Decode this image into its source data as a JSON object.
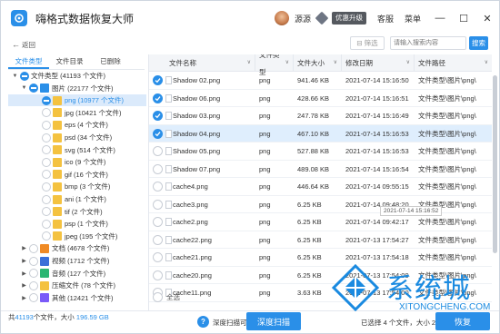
{
  "app": {
    "title": "嗨格式数据恢复大师",
    "user": "源源",
    "upgrade": "优惠升级",
    "service": "客服",
    "menu": "菜单"
  },
  "toolbar": {
    "back": "返回",
    "filter": "筛选",
    "search_placeholder": "请输入搜索内容",
    "search_btn": "搜索"
  },
  "left": {
    "tabs": [
      "文件类型",
      "文件目录",
      "已删除"
    ],
    "tree": [
      {
        "label": "文件类型 (41193 个文件)",
        "lvl": 0,
        "arrow": "▼",
        "cb": "part",
        "icon": null
      },
      {
        "label": "图片 (22177 个文件)",
        "lvl": 1,
        "arrow": "▼",
        "cb": "part",
        "icon": "#2a8fe8"
      },
      {
        "label": "png (10977 个文件)",
        "lvl": 2,
        "arrow": "",
        "cb": "full",
        "icon": "#f4c240",
        "sel": true
      },
      {
        "label": "jpg (10421 个文件)",
        "lvl": 2,
        "arrow": "",
        "cb": "",
        "icon": "#f4c240"
      },
      {
        "label": "eps (4 个文件)",
        "lvl": 2,
        "arrow": "",
        "cb": "",
        "icon": "#f4c240"
      },
      {
        "label": "psd (34 个文件)",
        "lvl": 2,
        "arrow": "",
        "cb": "",
        "icon": "#f4c240"
      },
      {
        "label": "svg (514 个文件)",
        "lvl": 2,
        "arrow": "",
        "cb": "",
        "icon": "#f4c240"
      },
      {
        "label": "ico (9 个文件)",
        "lvl": 2,
        "arrow": "",
        "cb": "",
        "icon": "#f4c240"
      },
      {
        "label": "gif (16 个文件)",
        "lvl": 2,
        "arrow": "",
        "cb": "",
        "icon": "#f4c240"
      },
      {
        "label": "bmp (3 个文件)",
        "lvl": 2,
        "arrow": "",
        "cb": "",
        "icon": "#f4c240"
      },
      {
        "label": "ani (1 个文件)",
        "lvl": 2,
        "arrow": "",
        "cb": "",
        "icon": "#f4c240"
      },
      {
        "label": "tif (2 个文件)",
        "lvl": 2,
        "arrow": "",
        "cb": "",
        "icon": "#f4c240"
      },
      {
        "label": "psp (1 个文件)",
        "lvl": 2,
        "arrow": "",
        "cb": "",
        "icon": "#f4c240"
      },
      {
        "label": "jpeg (195 个文件)",
        "lvl": 2,
        "arrow": "",
        "cb": "",
        "icon": "#f4c240"
      },
      {
        "label": "文档 (4678 个文件)",
        "lvl": 1,
        "arrow": "▶",
        "cb": "",
        "icon": "#f08a24"
      },
      {
        "label": "视频 (1712 个文件)",
        "lvl": 1,
        "arrow": "▶",
        "cb": "",
        "icon": "#3a6fd8"
      },
      {
        "label": "音频 (127 个文件)",
        "lvl": 1,
        "arrow": "▶",
        "cb": "",
        "icon": "#2bb673"
      },
      {
        "label": "压缩文件 (78 个文件)",
        "lvl": 1,
        "arrow": "▶",
        "cb": "",
        "icon": "#f4c240"
      },
      {
        "label": "其他 (12421 个文件)",
        "lvl": 1,
        "arrow": "▶",
        "cb": "",
        "icon": "#7a5af8"
      }
    ],
    "footer_prefix": "共",
    "footer_count": "41193",
    "footer_mid": "个文件，大小",
    "footer_size": "196.59 GB"
  },
  "grid": {
    "headers": [
      "文件名称",
      "文件类型",
      "文件大小",
      "修改日期",
      "文件路径"
    ],
    "rows": [
      {
        "name": "Shadow 02.png",
        "type": "png",
        "size": "941.46 KB",
        "date": "2021-07-14 15:16:50",
        "path": "文件类型\\图片\\png\\",
        "checked": true
      },
      {
        "name": "Shadow 06.png",
        "type": "png",
        "size": "428.66 KB",
        "date": "2021-07-14 15:16:51",
        "path": "文件类型\\图片\\png\\",
        "checked": true
      },
      {
        "name": "Shadow 03.png",
        "type": "png",
        "size": "247.78 KB",
        "date": "2021-07-14 15:16:49",
        "path": "文件类型\\图片\\png\\",
        "checked": true
      },
      {
        "name": "Shadow 04.png",
        "type": "png",
        "size": "467.10 KB",
        "date": "2021-07-14 15:16:53",
        "path": "文件类型\\图片\\png\\",
        "checked": true,
        "sel": true
      },
      {
        "name": "Shadow 05.png",
        "type": "png",
        "size": "527.88 KB",
        "date": "2021-07-14 15:16:53",
        "path": "文件类型\\图片\\png\\",
        "checked": false
      },
      {
        "name": "Shadow 07.png",
        "type": "png",
        "size": "489.08 KB",
        "date": "2021-07-14 15:16:54",
        "path": "文件类型\\图片\\png\\",
        "checked": false
      },
      {
        "name": "cache4.png",
        "type": "png",
        "size": "446.64 KB",
        "date": "2021-07-14 09:55:15",
        "path": "文件类型\\图片\\png\\",
        "checked": false
      },
      {
        "name": "cache3.png",
        "type": "png",
        "size": "6.25 KB",
        "date": "2021-07-14 09:48:20",
        "path": "文件类型\\图片\\png\\",
        "checked": false
      },
      {
        "name": "cache2.png",
        "type": "png",
        "size": "6.25 KB",
        "date": "2021-07-14 09:42:17",
        "path": "文件类型\\图片\\png\\",
        "checked": false
      },
      {
        "name": "cache22.png",
        "type": "png",
        "size": "6.25 KB",
        "date": "2021-07-13 17:54:27",
        "path": "文件类型\\图片\\png\\",
        "checked": false
      },
      {
        "name": "cache21.png",
        "type": "png",
        "size": "6.25 KB",
        "date": "2021-07-13 17:54:18",
        "path": "文件类型\\图片\\png\\",
        "checked": false
      },
      {
        "name": "cache20.png",
        "type": "png",
        "size": "6.25 KB",
        "date": "2021-07-13 17:54:09",
        "path": "文件类型\\图片\\png\\",
        "checked": false
      },
      {
        "name": "cache11.png",
        "type": "png",
        "size": "3.63 KB",
        "date": "2021-07-13 17:54:00",
        "path": "文件类型\\图片\\png\\",
        "checked": false
      }
    ],
    "tooltip": "2021-07-14 15:16:52",
    "select_all": "全选"
  },
  "footer": {
    "hint": "深度扫描可以找到更多文件",
    "deep": "深度扫描",
    "selected": "已选择 4 个文件，大小 2.04 MB",
    "recover": "恢复"
  },
  "watermark": {
    "text": "系统城",
    "sub": "XITONGCHENG.COM"
  }
}
